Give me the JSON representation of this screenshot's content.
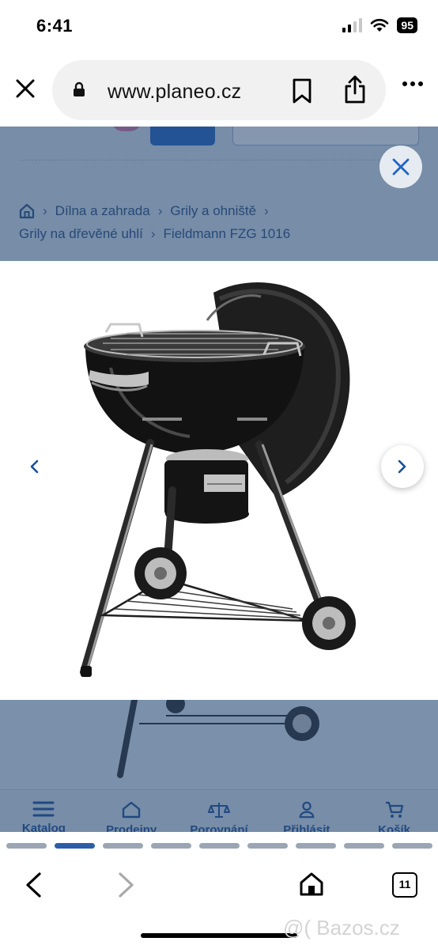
{
  "status_bar": {
    "time": "6:41",
    "battery": "95"
  },
  "browser": {
    "url": "www.planeo.cz"
  },
  "breadcrumb": {
    "items": [
      "Dílna a zahrada",
      "Grily a ohniště",
      "Grily na dřevěné uhlí",
      "Fieldmann FZG 1016"
    ]
  },
  "bottom_nav": {
    "items": [
      {
        "label": "Katalog",
        "icon": "menu-icon"
      },
      {
        "label": "Prodejny",
        "icon": "store-icon"
      },
      {
        "label": "Porovnání",
        "icon": "scale-icon"
      },
      {
        "label": "Přihlásit",
        "icon": "user-icon"
      },
      {
        "label": "Košík",
        "icon": "cart-icon"
      }
    ]
  },
  "tab_strip": {
    "count": 9,
    "active_index": 1
  },
  "toolbar": {
    "tab_count": "11"
  },
  "watermark": "@( Bazos.cz",
  "colors": {
    "brand_blue": "#2064c5",
    "overlay": "#26466e",
    "active_tab": "#2c5ea7"
  }
}
